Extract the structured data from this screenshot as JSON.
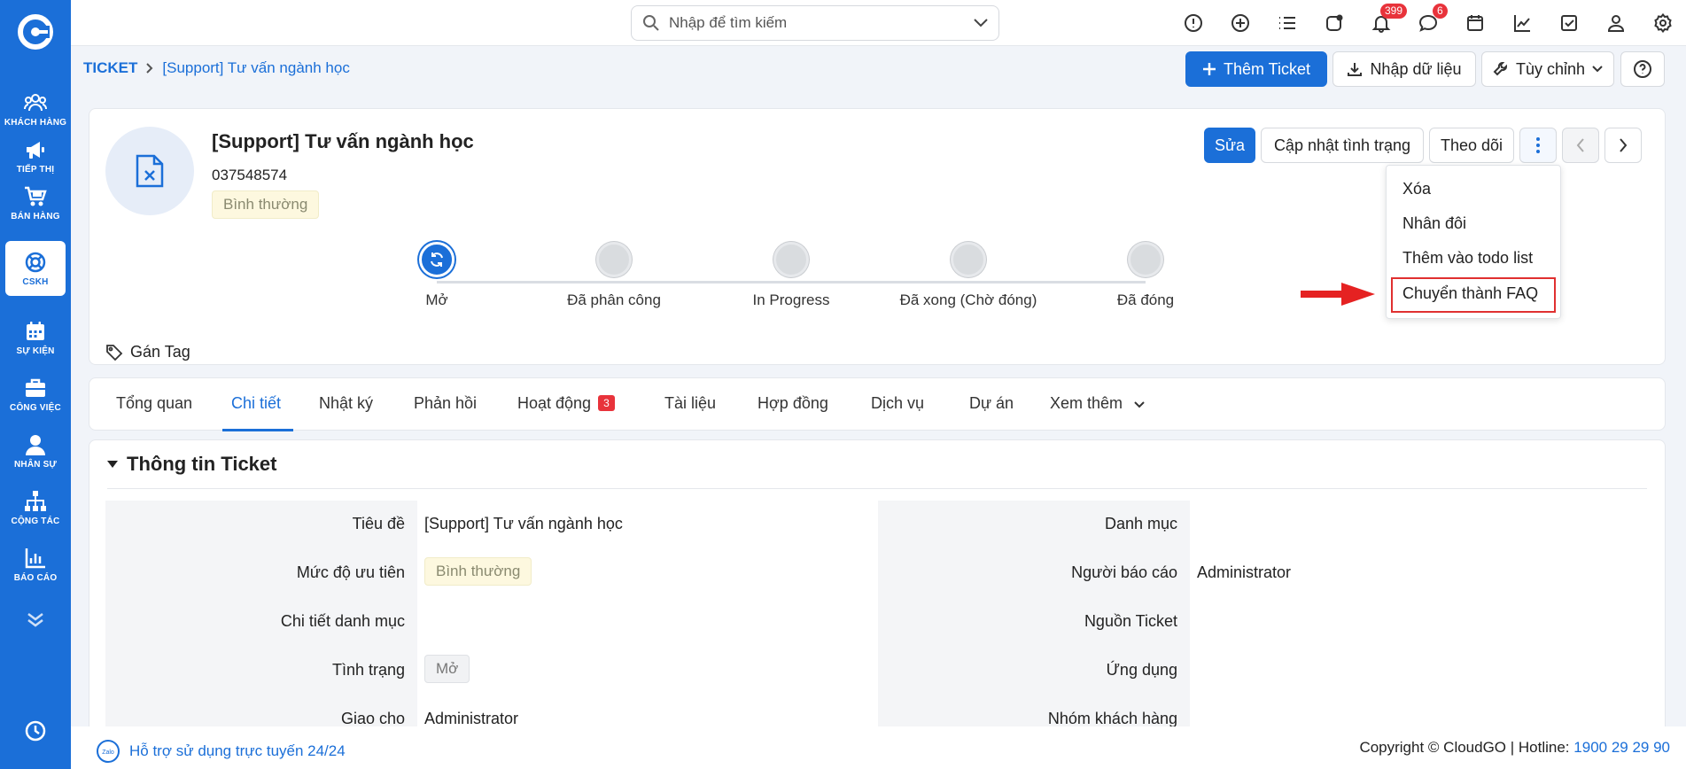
{
  "search": {
    "placeholder": "Nhập để tìm kiếm"
  },
  "top_badges": {
    "notifications": "399",
    "messages": "6"
  },
  "sidebar": {
    "items": [
      {
        "label": "KHÁCH HÀNG",
        "icon": "users-icon"
      },
      {
        "label": "TIẾP THỊ",
        "icon": "megaphone-icon"
      },
      {
        "label": "BÁN HÀNG",
        "icon": "cart-icon"
      },
      {
        "label": "CSKH",
        "icon": "lifebuoy-icon"
      },
      {
        "label": "SỰ KIỆN",
        "icon": "calendar-icon"
      },
      {
        "label": "CÔNG VIỆC",
        "icon": "briefcase-icon"
      },
      {
        "label": "NHÂN SỰ",
        "icon": "person-icon"
      },
      {
        "label": "CỘNG TÁC",
        "icon": "org-chart-icon"
      },
      {
        "label": "BÁO CÁO",
        "icon": "report-icon"
      }
    ]
  },
  "breadcrumb": {
    "root": "TICKET",
    "current": "[Support] Tư vấn ngành học"
  },
  "actions": {
    "add_ticket": "Thêm Ticket",
    "import": "Nhập dữ liệu",
    "customize": "Tùy chỉnh"
  },
  "ticket": {
    "title": "[Support] Tư vấn ngành học",
    "phone": "037548574",
    "priority": "Bình thường"
  },
  "header_buttons": {
    "edit": "Sửa",
    "update_status": "Cập nhật tình trạng",
    "follow": "Theo dõi"
  },
  "dropdown": {
    "delete": "Xóa",
    "duplicate": "Nhân đôi",
    "add_todo": "Thêm vào todo list",
    "to_faq": "Chuyển thành FAQ"
  },
  "steps": [
    "Mở",
    "Đã phân công",
    "In Progress",
    "Đã xong (Chờ đóng)",
    "Đã đóng"
  ],
  "tag_label": "Gán Tag",
  "tabs": {
    "overview": "Tổng quan",
    "detail": "Chi tiết",
    "log": "Nhật ký",
    "feedback": "Phản hồi",
    "activity": "Hoạt động",
    "activity_count": "3",
    "documents": "Tài liệu",
    "contracts": "Hợp đồng",
    "services": "Dịch vụ",
    "projects": "Dự án",
    "more": "Xem thêm"
  },
  "section": {
    "title": "Thông tin Ticket",
    "left": {
      "title_label": "Tiêu đề",
      "title_value": "[Support] Tư vấn ngành học",
      "priority_label": "Mức độ ưu tiên",
      "priority_value": "Bình thường",
      "cat_detail_label": "Chi tiết danh mục",
      "status_label": "Tình trạng",
      "status_value": "Mở",
      "assign_label": "Giao cho",
      "assign_value": "Administrator"
    },
    "right": {
      "category_label": "Danh mục",
      "reporter_label": "Người báo cáo",
      "reporter_value": "Administrator",
      "source_label": "Nguồn Ticket",
      "app_label": "Ứng dụng",
      "group_label": "Nhóm khách hàng"
    }
  },
  "footer": {
    "zalo": "Zalo",
    "support": "Hỗ trợ sử dụng trực tuyến 24/24",
    "copyright": "Copyright © CloudGO | Hotline:",
    "hotline": "1900 29 29 90"
  },
  "colors": {
    "brand": "#1b6fd8",
    "badge": "#e8333b",
    "highlight": "#e03030"
  }
}
